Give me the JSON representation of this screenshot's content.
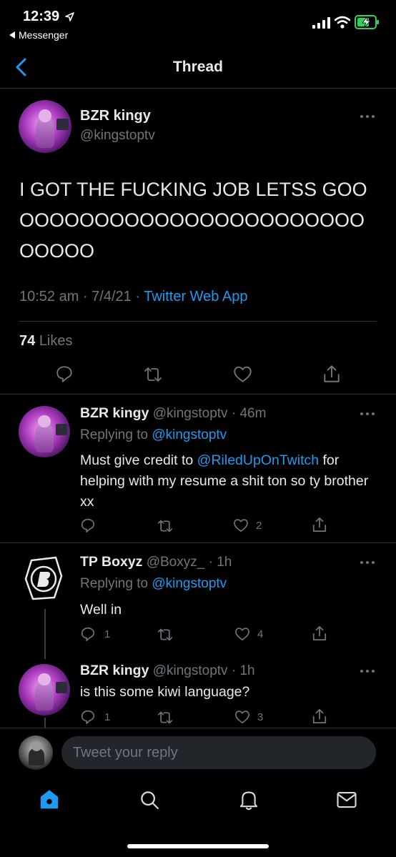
{
  "status_bar": {
    "time": "12:39",
    "back_app": "Messenger"
  },
  "header": {
    "title": "Thread"
  },
  "main_tweet": {
    "name": "BZR kingy",
    "handle": "@kingstoptv",
    "text": "I GOT THE FUCKING JOB LETSS GOOOOOOOOOOOOOOOOOOOOOOOOOOOOOO",
    "time": "10:52 am",
    "date": "7/4/21",
    "source": "Twitter Web App",
    "likes_count": "74",
    "likes_label": "Likes"
  },
  "replies": [
    {
      "name": "BZR kingy",
      "handle": "@kingstoptv",
      "age": "46m",
      "replying_to_label": "Replying to",
      "replying_to": "@kingstoptv",
      "text_before": "Must give credit to ",
      "mention": "@RiledUpOnTwitch",
      "text_after": " for helping with my resume a shit ton so ty brother xx",
      "reply_count": "",
      "retweet_count": "",
      "like_count": "2"
    },
    {
      "name": "TP Boxyz",
      "handle": "@Boxyz_",
      "age": "1h",
      "replying_to_label": "Replying to",
      "replying_to": "@kingstoptv",
      "text": "Well in",
      "reply_count": "1",
      "retweet_count": "",
      "like_count": "4"
    },
    {
      "name": "BZR kingy",
      "handle": "@kingstoptv",
      "age": "1h",
      "text": "is this some kiwi language?",
      "reply_count": "1",
      "retweet_count": "",
      "like_count": "3"
    }
  ],
  "compose": {
    "placeholder": "Tweet your reply"
  },
  "tabbar": {
    "items": [
      "home",
      "search",
      "notifications",
      "messages"
    ]
  },
  "colors": {
    "accent": "#1d9bf0",
    "background": "#000000"
  }
}
